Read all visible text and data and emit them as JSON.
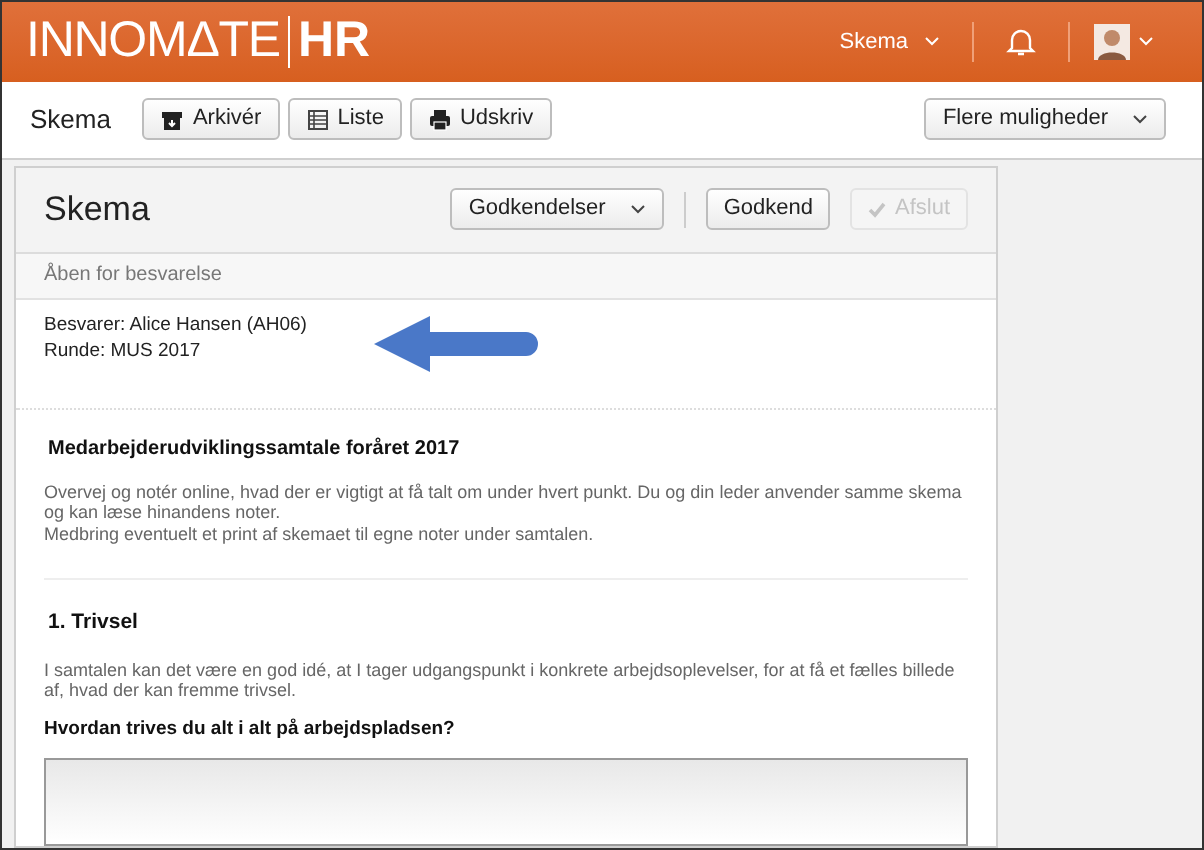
{
  "header": {
    "logo_left": "INNOMΔTE",
    "logo_right": "HR",
    "menu": "Skema"
  },
  "toolbar": {
    "title": "Skema",
    "buttons": [
      {
        "label": "Arkivér",
        "kind": "archive"
      },
      {
        "label": "Liste",
        "kind": "list"
      },
      {
        "label": "Udskriv",
        "kind": "print"
      }
    ],
    "more": "Flere muligheder"
  },
  "form": {
    "title": "Skema",
    "approvals": "Godkendelser",
    "approve": {
      "label": "Godkend",
      "disabled": false
    },
    "finish": {
      "label": "Afslut",
      "disabled": true
    },
    "status": "Åben for besvarelse",
    "meta": [
      "Besvarer: Alice Hansen (AH06)",
      "Runde: MUS 2017"
    ],
    "heading": "Medarbejderudviklingssamtale foråret 2017",
    "intro": [
      "Overvej og notér online, hvad der er vigtigt at få talt om under hvert punkt. Du og din leder anvender samme skema og kan læse hinandens noter.",
      "Medbring eventuelt et print af skemaet til egne noter under samtalen."
    ],
    "section": {
      "title": "1. Trivsel",
      "text": "I samtalen kan det være en god idé, at I tager udgangspunkt i konkrete arbejdsoplevelser, for at få et fælles billede af, hvad der kan fremme trivsel.",
      "question": "Hvordan trives du alt i alt på arbejdspladsen?"
    }
  }
}
